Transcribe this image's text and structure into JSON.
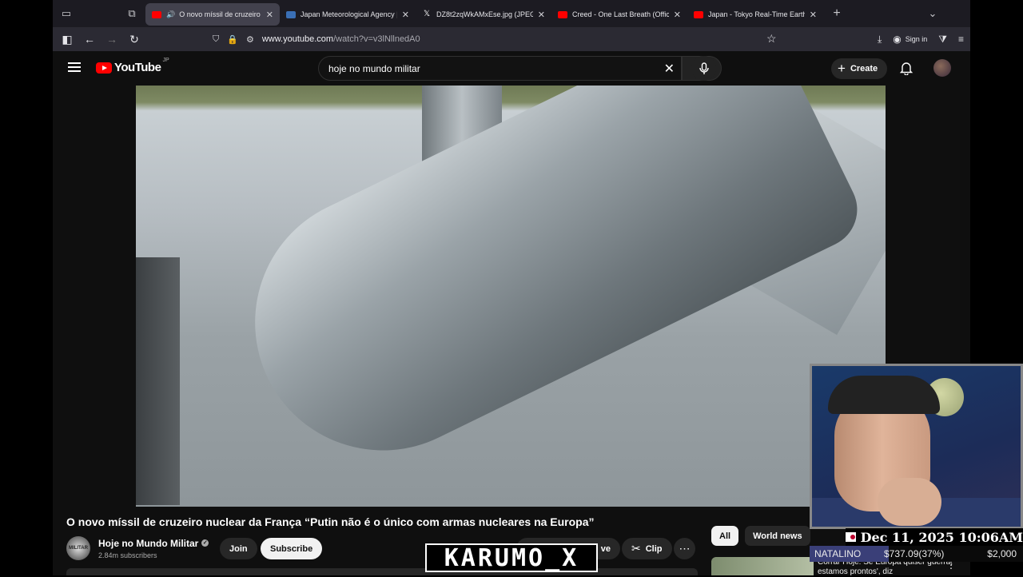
{
  "browser": {
    "tabs": [
      {
        "title": "O novo míssil de cruzeiro n",
        "favicon": "youtube",
        "active": true,
        "audio": true
      },
      {
        "title": "Japan Meteorological Agency | E",
        "favicon": "jma",
        "active": false
      },
      {
        "title": "DZ8t2zqWkAMxEse.jpg (JPEG I",
        "favicon": "x",
        "active": false
      },
      {
        "title": "Creed - One Last Breath (Officia",
        "favicon": "youtube",
        "active": false
      },
      {
        "title": "Japan - Tokyo Real-Time Earthq",
        "favicon": "youtube",
        "active": false
      }
    ],
    "url_domain": "www.youtube.com",
    "url_path": "/watch?v=v3lNllnedA0",
    "sign_in": "Sign in"
  },
  "youtube": {
    "logo_text": "YouTube",
    "region": "JP",
    "search_value": "hoje no mundo militar",
    "create_label": "Create"
  },
  "video": {
    "title": "O novo míssil de cruzeiro nuclear da França “Putin não é o único com armas nucleares na Europa”",
    "channel_name": "Hoje no Mundo Militar",
    "channel_avatar_text": "MILITAR",
    "subscribers": "2.84m subscribers",
    "join_label": "Join",
    "subscribe_label": "Subscribe",
    "save_label": "ve",
    "clip_label": "Clip"
  },
  "chips": [
    "All",
    "World news"
  ],
  "suggestion": {
    "text": "Corrar Hoje: Se Europa quiser guerra, estamos prontos', diz"
  },
  "overlay": {
    "date": "Dec 11, 2025 10:06AM",
    "donation_name": "NATALINO",
    "donation_amount": "$737.09(37%)",
    "donation_goal": "$2,000",
    "donation_progress": 0.37,
    "watermark": "KARUMO_X"
  }
}
